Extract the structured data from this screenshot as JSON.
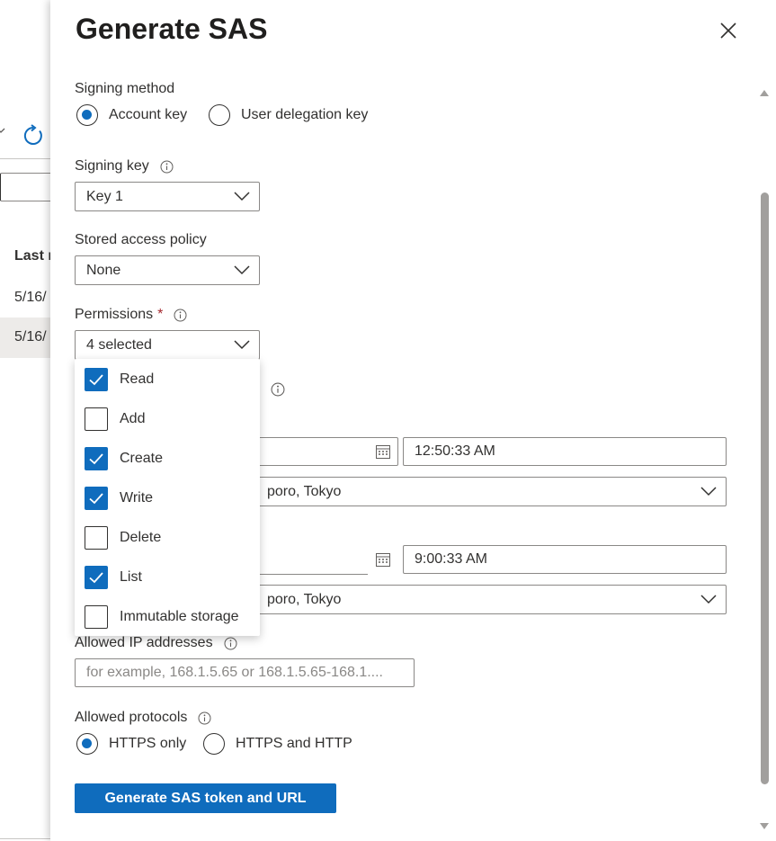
{
  "background": {
    "column_header": "Last m",
    "rows": [
      "5/16/",
      "5/16/"
    ]
  },
  "panel": {
    "title": "Generate SAS",
    "signing_method": {
      "label": "Signing method",
      "options": [
        "Account key",
        "User delegation key"
      ],
      "selected": "Account key"
    },
    "signing_key": {
      "label": "Signing key",
      "value": "Key 1"
    },
    "stored_access_policy": {
      "label": "Stored access policy",
      "value": "None"
    },
    "permissions": {
      "label": "Permissions",
      "required_mark": "*",
      "value": "4 selected",
      "options": [
        {
          "label": "Read",
          "checked": true
        },
        {
          "label": "Add",
          "checked": false
        },
        {
          "label": "Create",
          "checked": true
        },
        {
          "label": "Write",
          "checked": true
        },
        {
          "label": "Delete",
          "checked": false
        },
        {
          "label": "List",
          "checked": true
        },
        {
          "label": "Immutable storage",
          "checked": false
        }
      ]
    },
    "start": {
      "time": "12:50:33 AM",
      "timezone": "poro, Tokyo"
    },
    "expiry": {
      "time": "9:00:33 AM",
      "timezone": "poro, Tokyo"
    },
    "allowed_ip": {
      "label": "Allowed IP addresses",
      "placeholder": "for example, 168.1.5.65 or 168.1.5.65-168.1...."
    },
    "allowed_protocols": {
      "label": "Allowed protocols",
      "options": [
        "HTTPS only",
        "HTTPS and HTTP"
      ],
      "selected": "HTTPS only"
    },
    "generate_button": "Generate SAS token and URL"
  },
  "colors": {
    "accent": "#0f6cbd",
    "required": "#a4262c",
    "border": "#8a8886"
  }
}
